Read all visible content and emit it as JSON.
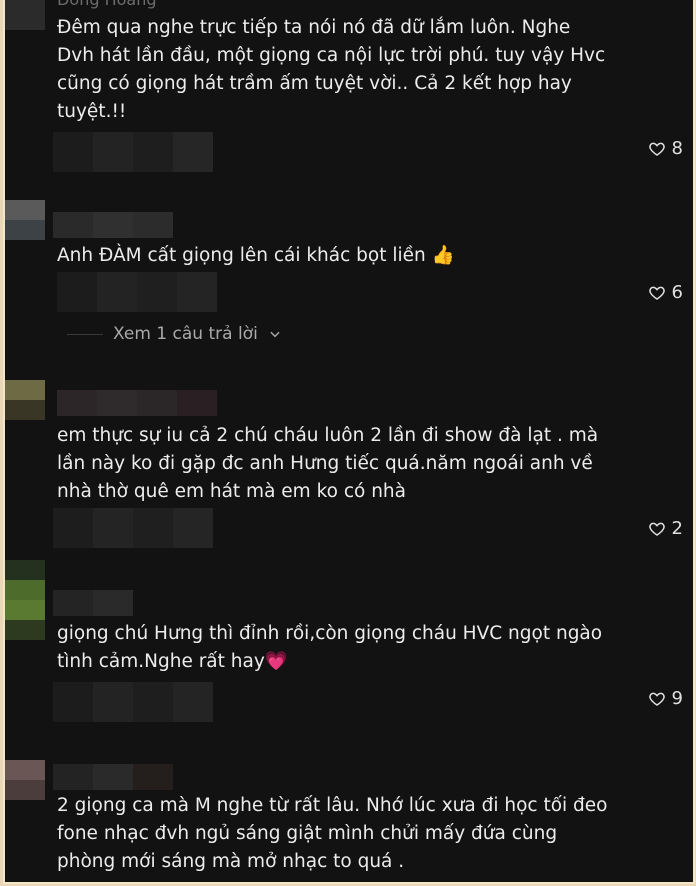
{
  "comments": [
    {
      "author_partial": "Đông Hoàng",
      "text": "Đêm qua nghe trực tiếp ta nói nó đã dữ lắm luôn. Nghe\nDvh hát lần đầu, một giọng ca nội lực trời phú. tuy vậy Hvc\ncũng có giọng hát trầm ấm tuyệt vời.. Cả 2 kết hợp hay\ntuyệt.!!",
      "likes": "8"
    },
    {
      "text": "Anh ĐÀM cất giọng lên cái khác bọt liền 👍",
      "likes": "6",
      "replies_label": "Xem 1 câu trả lời"
    },
    {
      "text": "em thực sự iu cả 2 chú cháu luôn 2 lần đi show đà lạt . mà\nlần này ko đi gặp đc anh Hưng tiếc quá.năm ngoái anh về\nnhà thờ quê em hát mà em ko có nhà",
      "likes": "2"
    },
    {
      "text": "giọng chú Hưng thì đỉnh rồi,còn giọng cháu HVC ngọt ngào\ntình cảm.Nghe rất hay💗",
      "likes": "9"
    },
    {
      "text": "2 giọng ca mà M nghe từ rất lâu. Nhớ lúc xưa đi học tối đeo\nfone nhạc đvh ngủ sáng giật mình chửi mấy đứa cùng\nphòng mới sáng mà mở nhạc to quá ."
    }
  ],
  "icons": {
    "like": "heart-outline-icon",
    "expand": "chevron-down-icon"
  },
  "colors": {
    "background": "#121212",
    "text": "#ececec",
    "muted": "#a9a9a9",
    "frame": "#f4e7c8"
  }
}
